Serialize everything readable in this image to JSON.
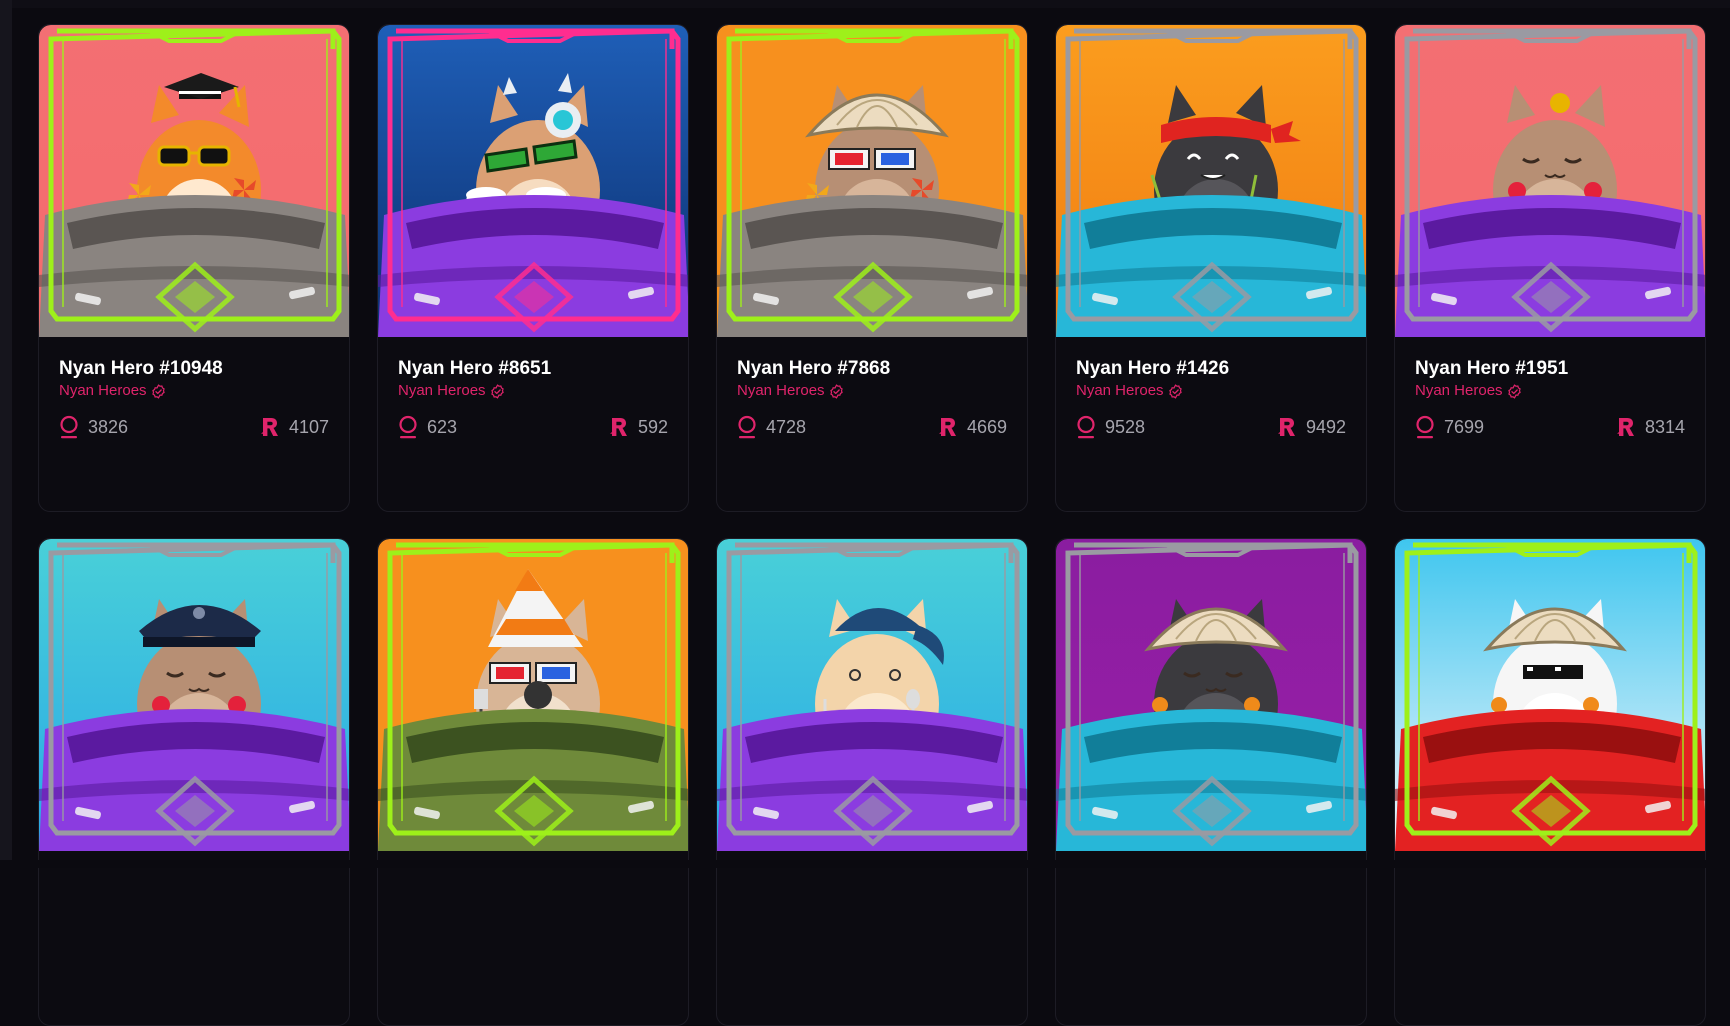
{
  "collection_name": "Nyan Heroes",
  "cards": [
    {
      "name": "Nyan Hero #10948",
      "collection": "Nyan Heroes",
      "level": "3826",
      "price": "4107",
      "bg_top": "#f36f73",
      "bg_bottom": "#f56b6d",
      "pod_color": "#8a8480",
      "pod_dark": "#5a5552",
      "frame_color": "#9ef01a",
      "cat_color": "#f38a2b",
      "cat_belly": "#ffe9cf",
      "hat": "grad",
      "eyes": "shades",
      "hands": "pinwheel"
    },
    {
      "name": "Nyan Hero #8651",
      "collection": "Nyan Heroes",
      "level": "623",
      "price": "592",
      "bg_top": "#1f5fb8",
      "bg_bottom": "#0c2f6e",
      "pod_color": "#8b3ce0",
      "pod_dark": "#5b1aa0",
      "frame_color": "#ff2d8f",
      "cat_color": "#dba074",
      "cat_belly": "#f6dcc0",
      "hat": "robot",
      "eyes": "green-shades",
      "hands": "beer"
    },
    {
      "name": "Nyan Hero #7868",
      "collection": "Nyan Heroes",
      "level": "4728",
      "price": "4669",
      "bg_top": "#f7901e",
      "bg_bottom": "#f7901e",
      "pod_color": "#8a8480",
      "pod_dark": "#5a5552",
      "frame_color": "#9ef01a",
      "cat_color": "#b78f74",
      "cat_belly": "#d7b59a",
      "hat": "shell",
      "eyes": "3d",
      "hands": "pinwheel"
    },
    {
      "name": "Nyan Hero #1426",
      "collection": "Nyan Heroes",
      "level": "9528",
      "price": "9492",
      "bg_top": "#fb9d1e",
      "bg_bottom": "#f07c12",
      "pod_color": "#27b7d8",
      "pod_dark": "#117e99",
      "frame_color": "#9a9aa2",
      "cat_color": "#3b3a3e",
      "cat_belly": "#56555a",
      "hat": "bandana",
      "eyes": "happy",
      "hands": "chopsticks"
    },
    {
      "name": "Nyan Hero #1951",
      "collection": "Nyan Heroes",
      "level": "7699",
      "price": "8314",
      "bg_top": "#f36f73",
      "bg_bottom": "#f56b6d",
      "pod_color": "#8b3ce0",
      "pod_dark": "#5b1aa0",
      "frame_color": "#9a9aa2",
      "cat_color": "#b78f74",
      "cat_belly": "#d7b59a",
      "hat": "bell",
      "eyes": "closed",
      "hands": "lollipop"
    },
    {
      "name": "",
      "collection": "",
      "level": "",
      "price": "",
      "bg_top": "#49d0d8",
      "bg_bottom": "#2aa9e6",
      "pod_color": "#8b3ce0",
      "pod_dark": "#5b1aa0",
      "frame_color": "#9a9aa2",
      "cat_color": "#b78f74",
      "cat_belly": "#d7b59a",
      "hat": "police",
      "eyes": "closed",
      "hands": "lollipop"
    },
    {
      "name": "",
      "collection": "",
      "level": "",
      "price": "",
      "bg_top": "#f7901e",
      "bg_bottom": "#f7901e",
      "pod_color": "#6f8a3a",
      "pod_dark": "#3c5220",
      "frame_color": "#9ef01a",
      "cat_color": "#d8b596",
      "cat_belly": "#f1e0cc",
      "hat": "cone",
      "eyes": "3d",
      "hands": "spatula"
    },
    {
      "name": "",
      "collection": "",
      "level": "",
      "price": "",
      "bg_top": "#49d0d8",
      "bg_bottom": "#2aa9e6",
      "pod_color": "#8b3ce0",
      "pod_dark": "#5b1aa0",
      "frame_color": "#9a9aa2",
      "cat_color": "#f3d4aa",
      "cat_belly": "#fbe8cc",
      "hat": "cap",
      "eyes": "dazed",
      "hands": "fork"
    },
    {
      "name": "",
      "collection": "",
      "level": "",
      "price": "",
      "bg_top": "#8a1da0",
      "bg_bottom": "#9a1ea8",
      "pod_color": "#27b7d8",
      "pod_dark": "#117e99",
      "frame_color": "#9a9aa2",
      "cat_color": "#3b3a3e",
      "cat_belly": "#56555a",
      "hat": "shell",
      "eyes": "closed",
      "hands": "flower"
    },
    {
      "name": "",
      "collection": "",
      "level": "",
      "price": "",
      "bg_top": "#3fc6ef",
      "bg_bottom": "#f1f6fb",
      "pod_color": "#e32222",
      "pod_dark": "#9a1010",
      "frame_color": "#9ef01a",
      "cat_color": "#f6f6f6",
      "cat_belly": "#ffffff",
      "hat": "shell",
      "eyes": "pixel-shades",
      "hands": "flower"
    }
  ]
}
